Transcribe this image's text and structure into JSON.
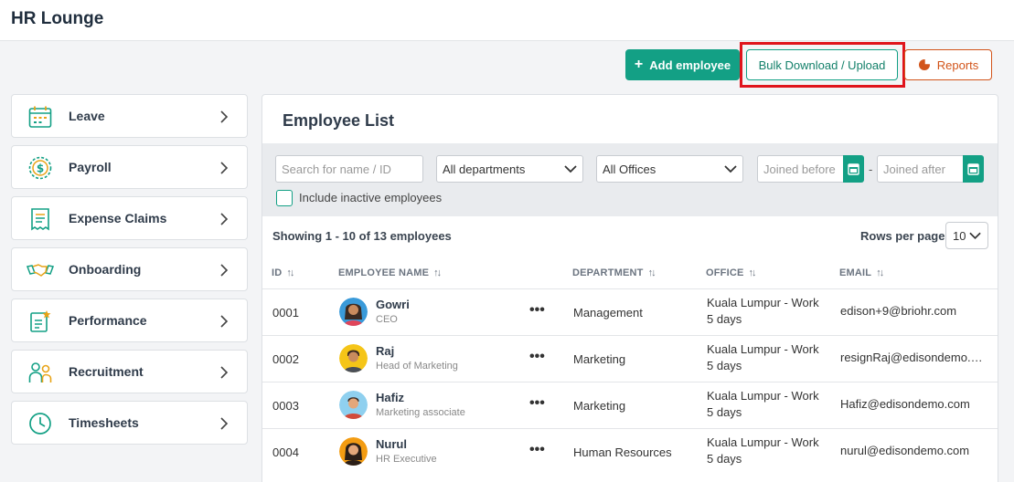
{
  "app": {
    "title": "HR Lounge"
  },
  "toolbar": {
    "add_employee_label": "Add employee",
    "bulk_label": "Bulk Download / Upload",
    "reports_label": "Reports"
  },
  "colors": {
    "accent": "#13a085",
    "reports": "#d2541a",
    "highlight": "#e0141c"
  },
  "sidebar": {
    "items": [
      {
        "label": "Leave",
        "icon": "calendar-icon"
      },
      {
        "label": "Payroll",
        "icon": "dollar-coin-icon"
      },
      {
        "label": "Expense Claims",
        "icon": "receipt-icon"
      },
      {
        "label": "Onboarding",
        "icon": "handshake-icon"
      },
      {
        "label": "Performance",
        "icon": "star-clipboard-icon"
      },
      {
        "label": "Recruitment",
        "icon": "people-icon"
      },
      {
        "label": "Timesheets",
        "icon": "clock-icon"
      }
    ]
  },
  "main": {
    "title": "Employee List",
    "filters": {
      "search_placeholder": "Search for name / ID",
      "department_value": "All departments",
      "office_value": "All Offices",
      "joined_before_placeholder": "Joined before",
      "joined_after_placeholder": "Joined after",
      "date_separator": "-",
      "inactive_label": "Include inactive employees"
    },
    "showing": "Showing 1 - 10 of 13 employees",
    "rows_per_page_label": "Rows per page",
    "rows_per_page_value": "10",
    "columns": [
      "ID",
      "EMPLOYEE NAME",
      "DEPARTMENT",
      "OFFICE",
      "EMAIL"
    ],
    "rows": [
      {
        "id": "0001",
        "name": "Gowri",
        "role": "CEO",
        "department": "Management",
        "office": "Kuala Lumpur - Work 5 days",
        "email": "edison+9@briohr.com"
      },
      {
        "id": "0002",
        "name": "Raj",
        "role": "Head of Marketing",
        "department": "Marketing",
        "office": "Kuala Lumpur - Work 5 days",
        "email": "resignRaj@edisondemo.com"
      },
      {
        "id": "0003",
        "name": "Hafiz",
        "role": "Marketing associate",
        "department": "Marketing",
        "office": "Kuala Lumpur - Work 5 days",
        "email": "Hafiz@edisondemo.com"
      },
      {
        "id": "0004",
        "name": "Nurul",
        "role": "HR Executive",
        "department": "Human Resources",
        "office": "Kuala Lumpur - Work 5 days",
        "email": "nurul@edisondemo.com"
      }
    ]
  }
}
